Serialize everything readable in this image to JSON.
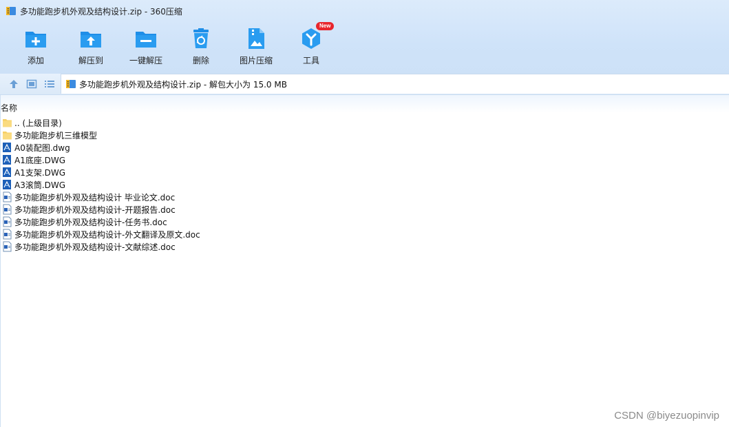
{
  "window": {
    "title": "多功能跑步机外观及结构设计.zip - 360压缩"
  },
  "toolbar": {
    "buttons": [
      {
        "label": "添加",
        "icon": "add-folder-icon"
      },
      {
        "label": "解压到",
        "icon": "extract-to-icon"
      },
      {
        "label": "一键解压",
        "icon": "one-click-extract-icon"
      },
      {
        "label": "删除",
        "icon": "trash-icon"
      },
      {
        "label": "图片压缩",
        "icon": "image-compress-icon"
      },
      {
        "label": "工具",
        "icon": "tools-icon",
        "badge": "New"
      }
    ]
  },
  "address": {
    "path": "多功能跑步机外观及结构设计.zip - 解包大小为 15.0 MB"
  },
  "columns": {
    "name": "名称"
  },
  "files": [
    {
      "name": ".. (上级目录)",
      "type": "folder"
    },
    {
      "name": "多功能跑步机三维模型",
      "type": "folder"
    },
    {
      "name": "A0装配图.dwg",
      "type": "dwg"
    },
    {
      "name": "A1底座.DWG",
      "type": "dwg"
    },
    {
      "name": "A1支架.DWG",
      "type": "dwg"
    },
    {
      "name": "A3滚筒.DWG",
      "type": "dwg"
    },
    {
      "name": "多功能跑步机外观及结构设计 毕业论文.doc",
      "type": "doc"
    },
    {
      "name": "多功能跑步机外观及结构设计-开题报告.doc",
      "type": "doc"
    },
    {
      "name": "多功能跑步机外观及结构设计-任务书.doc",
      "type": "doc"
    },
    {
      "name": "多功能跑步机外观及结构设计-外文翻译及原文.doc",
      "type": "doc"
    },
    {
      "name": "多功能跑步机外观及结构设计-文献综述.doc",
      "type": "doc"
    }
  ],
  "watermark": "CSDN @biyezuopinvip",
  "colors": {
    "accent": "#1e8ee8",
    "toolbar_bg": "#d3e5f9",
    "badge": "#e8262d"
  }
}
